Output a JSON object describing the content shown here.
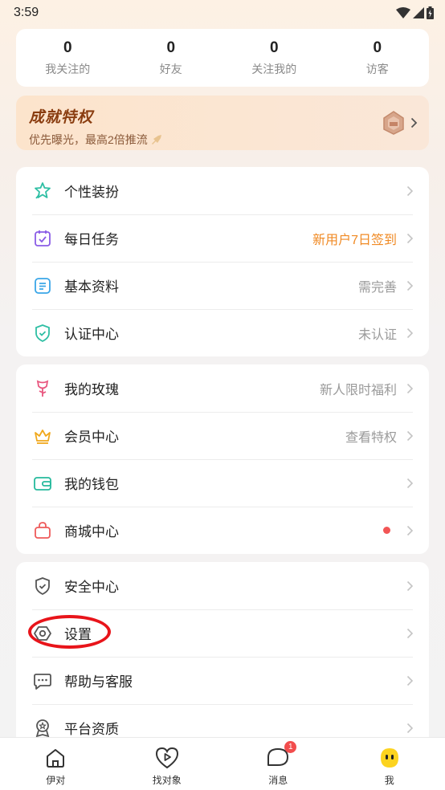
{
  "status_bar": {
    "time": "3:59"
  },
  "stats": [
    {
      "value": "0",
      "label": "我关注的"
    },
    {
      "value": "0",
      "label": "好友"
    },
    {
      "value": "0",
      "label": "关注我的"
    },
    {
      "value": "0",
      "label": "访客"
    }
  ],
  "privilege": {
    "title": "成就特权",
    "subtitle": "优先曝光，最高2倍推流"
  },
  "group1": [
    {
      "label": "个性装扮",
      "value": "",
      "icon": "dress-up-icon"
    },
    {
      "label": "每日任务",
      "value": "新用户7日签到",
      "icon": "calendar-check-icon"
    },
    {
      "label": "基本资料",
      "value": "需完善",
      "icon": "profile-doc-icon"
    },
    {
      "label": "认证中心",
      "value": "未认证",
      "icon": "shield-check-icon"
    }
  ],
  "group2": [
    {
      "label": "我的玫瑰",
      "value": "新人限时福利",
      "icon": "rose-icon"
    },
    {
      "label": "会员中心",
      "value": "查看特权",
      "icon": "crown-icon"
    },
    {
      "label": "我的钱包",
      "value": "",
      "icon": "wallet-icon"
    },
    {
      "label": "商城中心",
      "value": "",
      "icon": "shopping-bag-icon"
    }
  ],
  "group3": [
    {
      "label": "安全中心",
      "value": "",
      "icon": "security-shield-icon"
    },
    {
      "label": "设置",
      "value": "",
      "icon": "settings-icon"
    },
    {
      "label": "帮助与客服",
      "value": "",
      "icon": "chat-help-icon"
    },
    {
      "label": "平台资质",
      "value": "",
      "icon": "certificate-icon"
    }
  ],
  "tabs": [
    {
      "label": "伊对",
      "icon": "home-icon"
    },
    {
      "label": "找对象",
      "icon": "play-heart-icon"
    },
    {
      "label": "消息",
      "icon": "message-icon",
      "badge": "1"
    },
    {
      "label": "我",
      "icon": "me-face-icon"
    }
  ],
  "colors": {
    "accent_orange": "#f08a24",
    "badge_red": "#f24d4d",
    "annotation_red": "#e8141a",
    "privilege_title": "#8a3d10"
  }
}
